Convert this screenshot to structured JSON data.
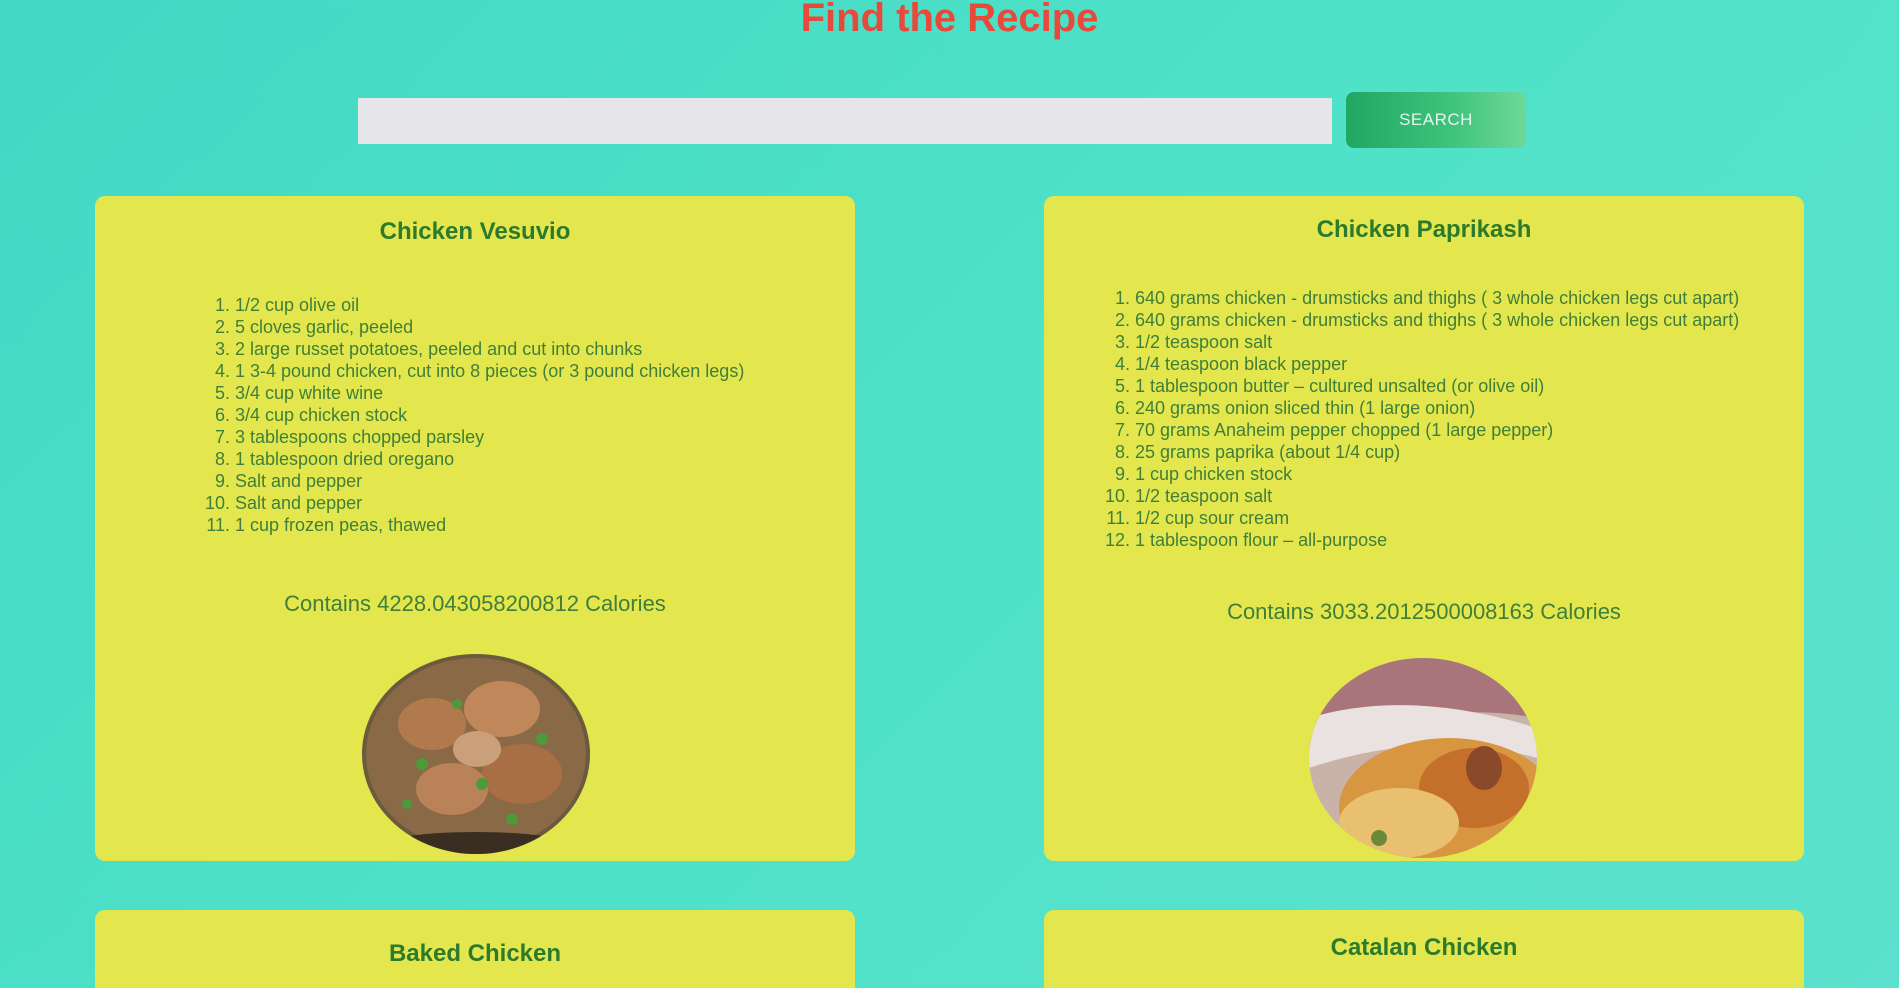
{
  "header": {
    "title": "Find the Recipe"
  },
  "search": {
    "value": "",
    "placeholder": "",
    "button_label": "SEARCH"
  },
  "colors": {
    "background": "#4fe2c8",
    "title": "#e8493a",
    "card": "#e3e74d",
    "card_text": "#3f7f3a",
    "card_title": "#2c7a2c",
    "button": "#2fb56d",
    "search_field": "#e6e6ea"
  },
  "recipes": [
    {
      "title": "Chicken Vesuvio",
      "ingredients": [
        "1/2 cup olive oil",
        "5 cloves garlic, peeled",
        "2 large russet potatoes, peeled and cut into chunks",
        "1 3-4 pound chicken, cut into 8 pieces (or 3 pound chicken legs)",
        "3/4 cup white wine",
        "3/4 cup chicken stock",
        "3 tablespoons chopped parsley",
        "1 tablespoon dried oregano",
        "Salt and pepper",
        "Salt and pepper",
        "1 cup frozen peas, thawed"
      ],
      "calories": "Contains 4228.043058200812 Calories",
      "image": "chicken-vesuvio-dish-photo"
    },
    {
      "title": "Chicken Paprikash",
      "ingredients": [
        "640 grams chicken - drumsticks and thighs ( 3 whole chicken legs cut apart)",
        "640 grams chicken - drumsticks and thighs ( 3 whole chicken legs cut apart)",
        "1/2 teaspoon salt",
        "1/4 teaspoon black pepper",
        "1 tablespoon butter – cultured unsalted (or olive oil)",
        "240 grams onion sliced thin (1 large onion)",
        "70 grams Anaheim pepper chopped (1 large pepper)",
        "25 grams paprika (about 1/4 cup)",
        "1 cup chicken stock",
        "1/2 teaspoon salt",
        "1/2 cup sour cream",
        "1 tablespoon flour – all-purpose"
      ],
      "calories": "Contains 3033.2012500008163 Calories",
      "image": "chicken-paprikash-dish-photo"
    },
    {
      "title": "Baked Chicken"
    },
    {
      "title": "Catalan Chicken"
    }
  ]
}
